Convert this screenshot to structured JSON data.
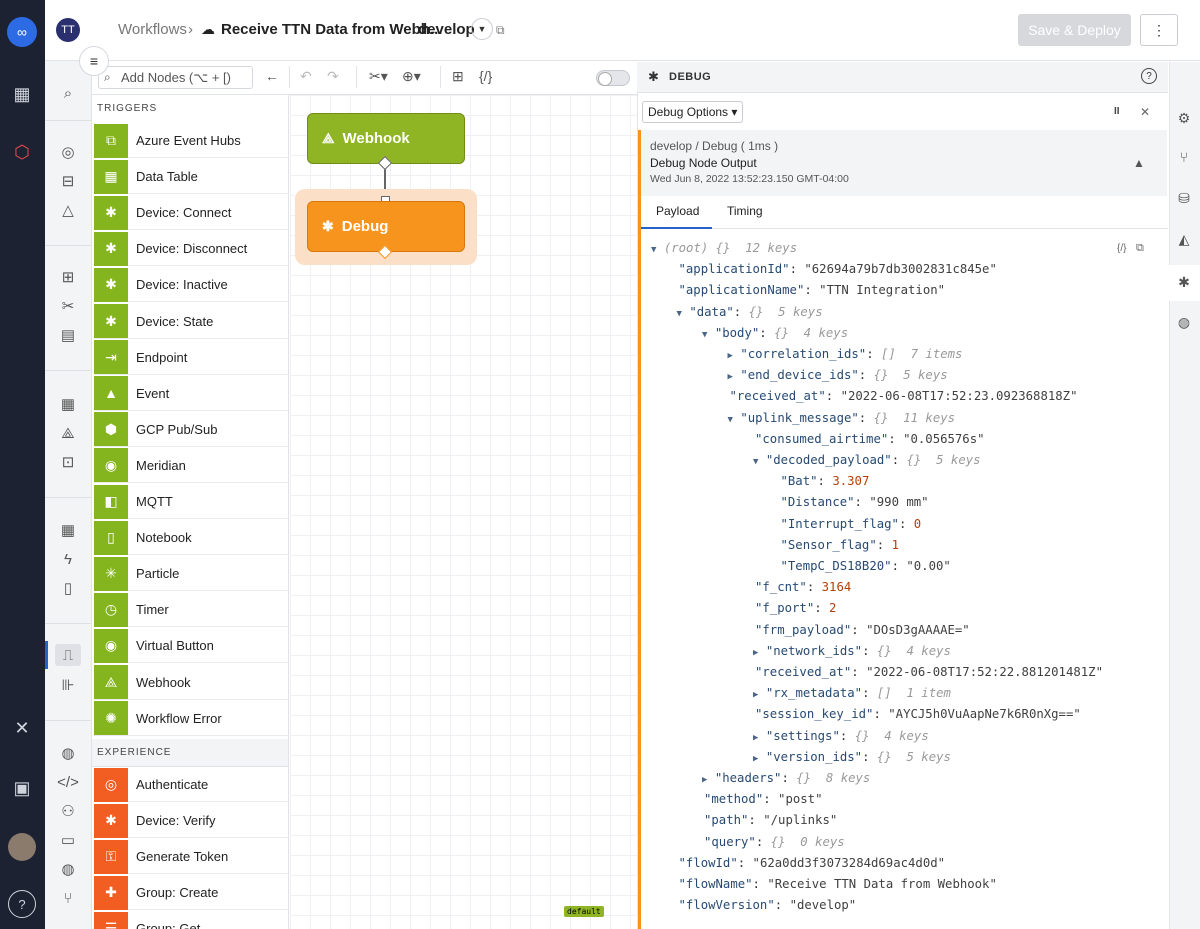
{
  "header": {
    "avatar_initials": "TT",
    "crumb_root": "Workflows",
    "crumb_sep": "›",
    "workflow_name": "Receive TTN Data from Webh...",
    "version": "develop",
    "save_deploy_label": "Save & Deploy",
    "more_label": "⋮"
  },
  "toolbar": {
    "search_placeholder": "Add Nodes (⌥ + [)"
  },
  "palette": {
    "triggers_heading": "TRIGGERS",
    "experience_heading": "EXPERIENCE",
    "triggers": [
      {
        "label": "Azure Event Hubs",
        "icon": "azure-icon",
        "glyph": "⧉"
      },
      {
        "label": "Data Table",
        "icon": "table-icon",
        "glyph": "▦"
      },
      {
        "label": "Device: Connect",
        "icon": "chip-icon",
        "glyph": "✱"
      },
      {
        "label": "Device: Disconnect",
        "icon": "chip-icon",
        "glyph": "✱"
      },
      {
        "label": "Device: Inactive",
        "icon": "chip-icon",
        "glyph": "✱"
      },
      {
        "label": "Device: State",
        "icon": "chip-icon",
        "glyph": "✱"
      },
      {
        "label": "Endpoint",
        "icon": "endpoint-icon",
        "glyph": "⇥"
      },
      {
        "label": "Event",
        "icon": "warning-icon",
        "glyph": "▲"
      },
      {
        "label": "GCP Pub/Sub",
        "icon": "gcp-icon",
        "glyph": "⬢"
      },
      {
        "label": "Meridian",
        "icon": "meridian-icon",
        "glyph": "◉"
      },
      {
        "label": "MQTT",
        "icon": "mqtt-icon",
        "glyph": "◧"
      },
      {
        "label": "Notebook",
        "icon": "notebook-icon",
        "glyph": "▯"
      },
      {
        "label": "Particle",
        "icon": "particle-icon",
        "glyph": "✳"
      },
      {
        "label": "Timer",
        "icon": "timer-icon",
        "glyph": "◷"
      },
      {
        "label": "Virtual Button",
        "icon": "button-icon",
        "glyph": "◉"
      },
      {
        "label": "Webhook",
        "icon": "webhook-icon",
        "glyph": "⟁"
      },
      {
        "label": "Workflow Error",
        "icon": "error-icon",
        "glyph": "✺"
      }
    ],
    "experience": [
      {
        "label": "Authenticate",
        "icon": "fingerprint-icon",
        "glyph": "◎"
      },
      {
        "label": "Device: Verify",
        "icon": "chip-icon",
        "glyph": "✱"
      },
      {
        "label": "Generate Token",
        "icon": "key-icon",
        "glyph": "⚿"
      },
      {
        "label": "Group: Create",
        "icon": "group-add-icon",
        "glyph": "✚"
      },
      {
        "label": "Group: Get",
        "icon": "group-icon",
        "glyph": "☰"
      }
    ]
  },
  "canvas": {
    "webhook_label": "Webhook",
    "debug_label": "Debug",
    "default_badge": "default"
  },
  "debug": {
    "panel_title": "DEBUG",
    "options_label": "Debug Options ▾",
    "pause_label": "II",
    "close_label": "✕",
    "msg_path": "develop / Debug ( 1ms )",
    "msg_title": "Debug Node Output",
    "msg_time": "Wed Jun 8, 2022 13:52:23.150 GMT-04:00",
    "tab_payload": "Payload",
    "tab_timing": "Timing"
  },
  "payload_lines": [
    {
      "indent": 0,
      "arrow": "▼",
      "key": "(root)",
      "val": "",
      "meta": "{}  12 keys",
      "type": "root"
    },
    {
      "indent": 1,
      "arrow": "",
      "key": "\"applicationId\"",
      "val": "\"62694a79b7db3002831c845e\"",
      "meta": "",
      "type": "s"
    },
    {
      "indent": 1,
      "arrow": "",
      "key": "\"applicationName\"",
      "val": "\"TTN Integration\"",
      "meta": "",
      "type": "s"
    },
    {
      "indent": 1,
      "arrow": "▼",
      "key": "\"data\"",
      "val": "",
      "meta": "{}  5 keys",
      "type": "o"
    },
    {
      "indent": 2,
      "arrow": "▼",
      "key": "\"body\"",
      "val": "",
      "meta": "{}  4 keys",
      "type": "o"
    },
    {
      "indent": 3,
      "arrow": "▶",
      "key": "\"correlation_ids\"",
      "val": "",
      "meta": "[]  7 items",
      "type": "o"
    },
    {
      "indent": 3,
      "arrow": "▶",
      "key": "\"end_device_ids\"",
      "val": "",
      "meta": "{}  5 keys",
      "type": "o"
    },
    {
      "indent": 3,
      "arrow": "",
      "key": "\"received_at\"",
      "val": "\"2022-06-08T17:52:23.092368818Z\"",
      "meta": "",
      "type": "s"
    },
    {
      "indent": 3,
      "arrow": "▼",
      "key": "\"uplink_message\"",
      "val": "",
      "meta": "{}  11 keys",
      "type": "o"
    },
    {
      "indent": 4,
      "arrow": "",
      "key": "\"consumed_airtime\"",
      "val": "\"0.056576s\"",
      "meta": "",
      "type": "s"
    },
    {
      "indent": 4,
      "arrow": "▼",
      "key": "\"decoded_payload\"",
      "val": "",
      "meta": "{}  5 keys",
      "type": "o"
    },
    {
      "indent": 5,
      "arrow": "",
      "key": "\"Bat\"",
      "val": "3.307",
      "meta": "",
      "type": "n"
    },
    {
      "indent": 5,
      "arrow": "",
      "key": "\"Distance\"",
      "val": "\"990 mm\"",
      "meta": "",
      "type": "s"
    },
    {
      "indent": 5,
      "arrow": "",
      "key": "\"Interrupt_flag\"",
      "val": "0",
      "meta": "",
      "type": "n"
    },
    {
      "indent": 5,
      "arrow": "",
      "key": "\"Sensor_flag\"",
      "val": "1",
      "meta": "",
      "type": "n"
    },
    {
      "indent": 5,
      "arrow": "",
      "key": "\"TempC_DS18B20\"",
      "val": "\"0.00\"",
      "meta": "",
      "type": "s"
    },
    {
      "indent": 4,
      "arrow": "",
      "key": "\"f_cnt\"",
      "val": "3164",
      "meta": "",
      "type": "n"
    },
    {
      "indent": 4,
      "arrow": "",
      "key": "\"f_port\"",
      "val": "2",
      "meta": "",
      "type": "n"
    },
    {
      "indent": 4,
      "arrow": "",
      "key": "\"frm_payload\"",
      "val": "\"DOsD3gAAAAE=\"",
      "meta": "",
      "type": "s"
    },
    {
      "indent": 4,
      "arrow": "▶",
      "key": "\"network_ids\"",
      "val": "",
      "meta": "{}  4 keys",
      "type": "o"
    },
    {
      "indent": 4,
      "arrow": "",
      "key": "\"received_at\"",
      "val": "\"2022-06-08T17:52:22.881201481Z\"",
      "meta": "",
      "type": "s"
    },
    {
      "indent": 4,
      "arrow": "▶",
      "key": "\"rx_metadata\"",
      "val": "",
      "meta": "[]  1 item",
      "type": "o"
    },
    {
      "indent": 4,
      "arrow": "",
      "key": "\"session_key_id\"",
      "val": "\"AYCJ5h0VuAapNe7k6R0nXg==\"",
      "meta": "",
      "type": "s"
    },
    {
      "indent": 4,
      "arrow": "▶",
      "key": "\"settings\"",
      "val": "",
      "meta": "{}  4 keys",
      "type": "o"
    },
    {
      "indent": 4,
      "arrow": "▶",
      "key": "\"version_ids\"",
      "val": "",
      "meta": "{}  5 keys",
      "type": "o"
    },
    {
      "indent": 2,
      "arrow": "▶",
      "key": "\"headers\"",
      "val": "",
      "meta": "{}  8 keys",
      "type": "o"
    },
    {
      "indent": 2,
      "arrow": "",
      "key": "\"method\"",
      "val": "\"post\"",
      "meta": "",
      "type": "s"
    },
    {
      "indent": 2,
      "arrow": "",
      "key": "\"path\"",
      "val": "\"/uplinks\"",
      "meta": "",
      "type": "s"
    },
    {
      "indent": 2,
      "arrow": "",
      "key": "\"query\"",
      "val": "",
      "meta": "{}  0 keys",
      "type": "o"
    },
    {
      "indent": 1,
      "arrow": "",
      "key": "\"flowId\"",
      "val": "\"62a0dd3f3073284d69ac4d0d\"",
      "meta": "",
      "type": "s"
    },
    {
      "indent": 1,
      "arrow": "",
      "key": "\"flowName\"",
      "val": "\"Receive TTN Data from Webhook\"",
      "meta": "",
      "type": "s"
    },
    {
      "indent": 1,
      "arrow": "",
      "key": "\"flowVersion\"",
      "val": "\"develop\"",
      "meta": "",
      "type": "s"
    }
  ],
  "colors": {
    "rail": "#1d2233",
    "trigger_green": "#84b51e",
    "experience_orange": "#f25d22",
    "debug_orange": "#f7941e",
    "tab_blue": "#2762c9"
  }
}
